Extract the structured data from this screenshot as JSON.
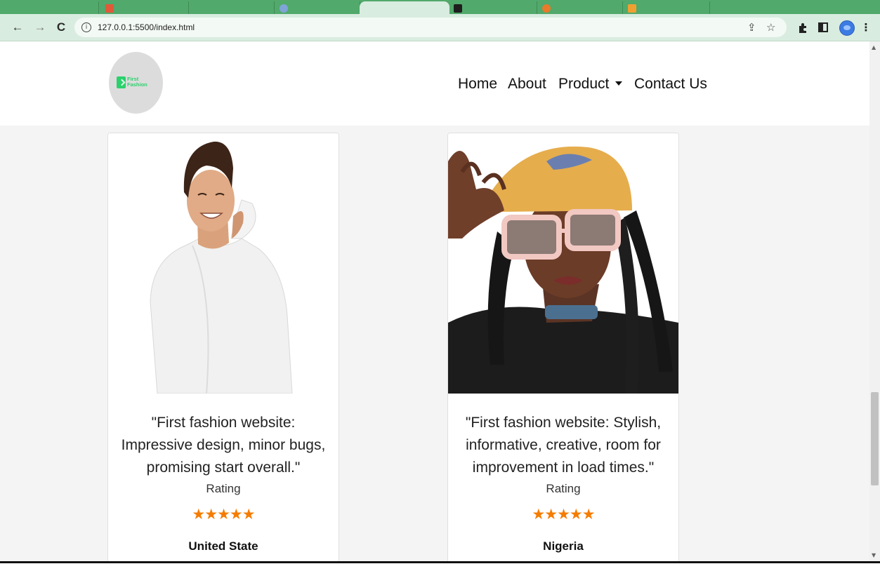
{
  "browser": {
    "url": "127.0.0.1:5500/index.html",
    "icons": [
      "back-arrow-icon",
      "forward-arrow-icon",
      "reload-icon",
      "info-icon",
      "share-icon",
      "star-bookmark-icon",
      "extensions-puzzle-icon",
      "side-panel-icon",
      "profile-avatar-icon",
      "menu-kebab-icon"
    ],
    "theme_color": "#51a96b",
    "toolbar_color": "#d9ece0"
  },
  "header": {
    "logo": {
      "line1": "First",
      "line2": "Fashion",
      "color": "#2bd16c"
    },
    "nav": [
      {
        "label": "Home"
      },
      {
        "label": "About"
      },
      {
        "label": "Product",
        "has_dropdown": true
      },
      {
        "label": "Contact Us"
      }
    ]
  },
  "testimonials": [
    {
      "image": "man-in-white-shirt-photo",
      "quote": "\"First fashion website: Impressive design, minor bugs, promising start overall.\"",
      "rating_label": "Rating",
      "stars": "★★★★★",
      "rating": 5,
      "country": "United State"
    },
    {
      "image": "woman-in-yellow-cap-and-sunglasses-photo",
      "quote": "\"First fashion website: Stylish, informative, creative, room for improvement in load times.\"",
      "rating_label": "Rating",
      "stars": "★★★★★",
      "rating": 5,
      "country": "Nigeria"
    }
  ],
  "colors": {
    "star": "#f57c00",
    "page_bg": "#f4f4f4"
  }
}
